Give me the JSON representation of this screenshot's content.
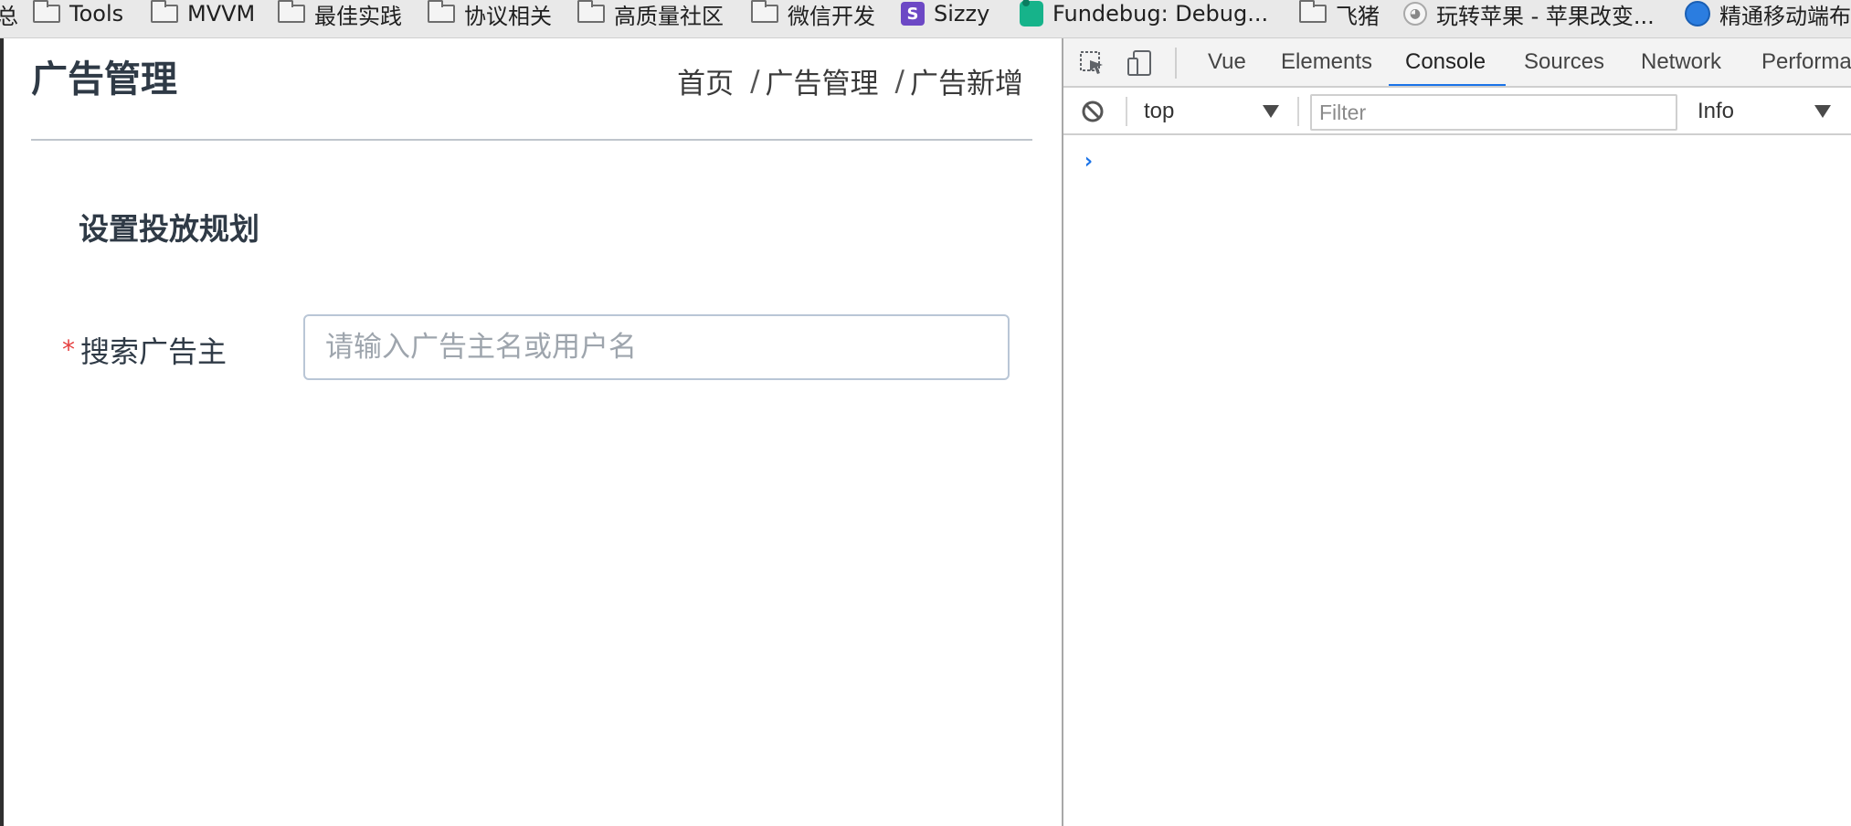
{
  "bookmarks": {
    "items": [
      {
        "label": "总",
        "icon": "none"
      },
      {
        "label": "Tools",
        "icon": "folder-icon"
      },
      {
        "label": "MVVM",
        "icon": "folder-icon"
      },
      {
        "label": "最佳实践",
        "icon": "folder-icon"
      },
      {
        "label": "协议相关",
        "icon": "folder-icon"
      },
      {
        "label": "高质量社区",
        "icon": "folder-icon"
      },
      {
        "label": "微信开发",
        "icon": "folder-icon"
      },
      {
        "label": "Sizzy",
        "icon": "sizzy-icon",
        "icon_text": "S"
      },
      {
        "label": "Fundebug: Debug...",
        "icon": "fundebug-icon"
      },
      {
        "label": "飞猪",
        "icon": "folder-icon"
      },
      {
        "label": "玩转苹果 - 苹果改变...",
        "icon": "pig-icon"
      },
      {
        "label": "精通移动端布",
        "icon": "circle-icon"
      }
    ]
  },
  "app": {
    "page_title": "广告管理",
    "breadcrumb": {
      "home": "首页",
      "separator": "/",
      "level1": "广告管理",
      "level2": "广告新增"
    },
    "section_title": "设置投放规划",
    "form": {
      "required_mark": "*",
      "advertiser_label": "搜索广告主",
      "advertiser_placeholder": "请输入广告主名或用户名",
      "advertiser_value": ""
    }
  },
  "devtools": {
    "tabs": [
      "Vue",
      "Elements",
      "Console",
      "Sources",
      "Network",
      "Performan"
    ],
    "active_tab": "Console",
    "console": {
      "context": "top",
      "filter_placeholder": "Filter",
      "level": "Info",
      "prompt": "›"
    }
  },
  "colors": {
    "accent": "#1a73e8",
    "required": "#e64242",
    "title": "#2f3a46",
    "input_border": "#b9c6d6"
  }
}
